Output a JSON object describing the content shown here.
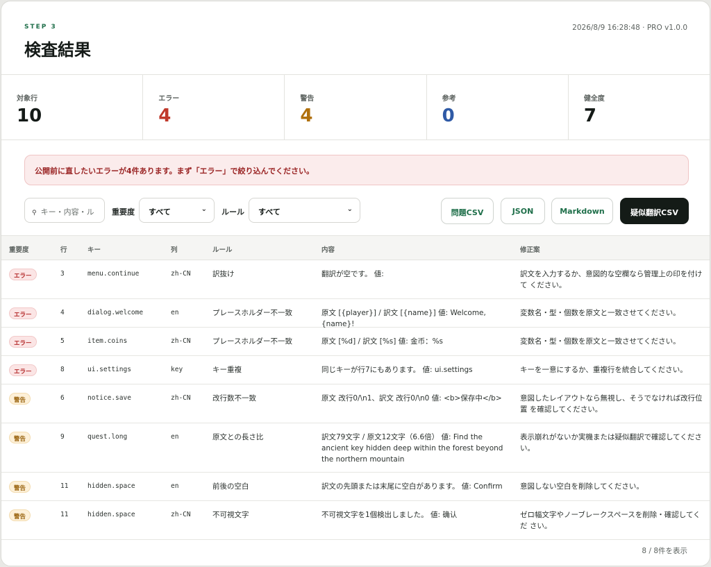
{
  "header": {
    "step": "STEP 3",
    "title": "検査結果",
    "meta": "2026/8/9 16:28:48 · PRO v1.0.0"
  },
  "stats": [
    {
      "label": "対象行",
      "value": "10",
      "color": "#141a17"
    },
    {
      "label": "エラー",
      "value": "4",
      "color": "#c0392b"
    },
    {
      "label": "警告",
      "value": "4",
      "color": "#b0700d"
    },
    {
      "label": "参考",
      "value": "0",
      "color": "#2f5aa6"
    },
    {
      "label": "健全度",
      "value": "7",
      "color": "#141a17"
    }
  ],
  "alert": "公開前に直したいエラーが4件あります。まず「エラー」で絞り込んでください。",
  "toolbar": {
    "search_placeholder": "キー・内容・ル",
    "severity_label": "重要度",
    "severity_value": "すべて",
    "rule_label": "ルール",
    "rule_value": "すべて",
    "btn_issues_csv": "問題CSV",
    "btn_json": "JSON",
    "btn_markdown": "Markdown",
    "btn_pseudo_csv": "疑似翻訳CSV"
  },
  "table": {
    "headers": {
      "severity": "重要度",
      "line": "行",
      "key": "キー",
      "column": "列",
      "rule": "ルール",
      "content": "内容",
      "fix": "修正案"
    },
    "rows": [
      {
        "severity": "エラー",
        "level": "error",
        "line": "3",
        "key": "menu.continue",
        "column": "zh-CN",
        "rule": "訳抜け",
        "content": "翻訳が空です。 値:",
        "fix": "訳文を入力するか、意図的な空欄なら管理上の印を付けて ください。"
      },
      {
        "severity": "エラー",
        "level": "error",
        "line": "4",
        "key": "dialog.welcome",
        "column": "en",
        "rule": "プレースホルダー不一致",
        "content": "原文 [{player}] / 訳文 [{name}] 値: Welcome, {name}!",
        "fix": "変数名・型・個数を原文と一致させてください。"
      },
      {
        "severity": "エラー",
        "level": "error",
        "line": "5",
        "key": "item.coins",
        "column": "zh-CN",
        "rule": "プレースホルダー不一致",
        "content": "原文 [%d] / 訳文 [%s] 値: 金币：%s",
        "fix": "変数名・型・個数を原文と一致させてください。"
      },
      {
        "severity": "エラー",
        "level": "error",
        "line": "8",
        "key": "ui.settings",
        "column": "key",
        "rule": "キー重複",
        "content": "同じキーが行7にもあります。 値: ui.settings",
        "fix": "キーを一意にするか、重複行を統合してください。"
      },
      {
        "severity": "警告",
        "level": "warn",
        "line": "6",
        "key": "notice.save",
        "column": "zh-CN",
        "rule": "改行数不一致",
        "content": "原文 改行0/\\n1、訳文 改行0/\\n0 値: <b>保存中</b>",
        "fix": "意図したレイアウトなら無視し、そうでなければ改行位置 を確認してください。"
      },
      {
        "severity": "警告",
        "level": "warn",
        "line": "9",
        "key": "quest.long",
        "column": "en",
        "rule": "原文との長さ比",
        "content": "訳文79文字 / 原文12文字（6.6倍） 値: Find the ancient key hidden deep within the forest beyond the northern mountain",
        "fix": "表示崩れがないか実機または疑似翻訳で確認してくださ い。"
      },
      {
        "severity": "警告",
        "level": "warn",
        "line": "11",
        "key": "hidden.space",
        "column": "en",
        "rule": "前後の空白",
        "content": "訳文の先頭または末尾に空白があります。 値: Confirm",
        "fix": "意図しない空白を削除してください。"
      },
      {
        "severity": "警告",
        "level": "warn",
        "line": "11",
        "key": "hidden.space",
        "column": "zh-CN",
        "rule": "不可視文字",
        "content": "不可視文字を1個検出しました。 値: 确认",
        "fix": "ゼロ幅文字やノーブレークスペースを削除・確認してくだ さい。"
      }
    ]
  },
  "footer": "8 / 8件を表示",
  "colors": {
    "accent": "#1f6f4a",
    "error": "#c0392b",
    "warn": "#b0700d",
    "info": "#2f5aa6"
  },
  "icons": {
    "search": "search-icon",
    "select": "chevron-down-icon"
  }
}
